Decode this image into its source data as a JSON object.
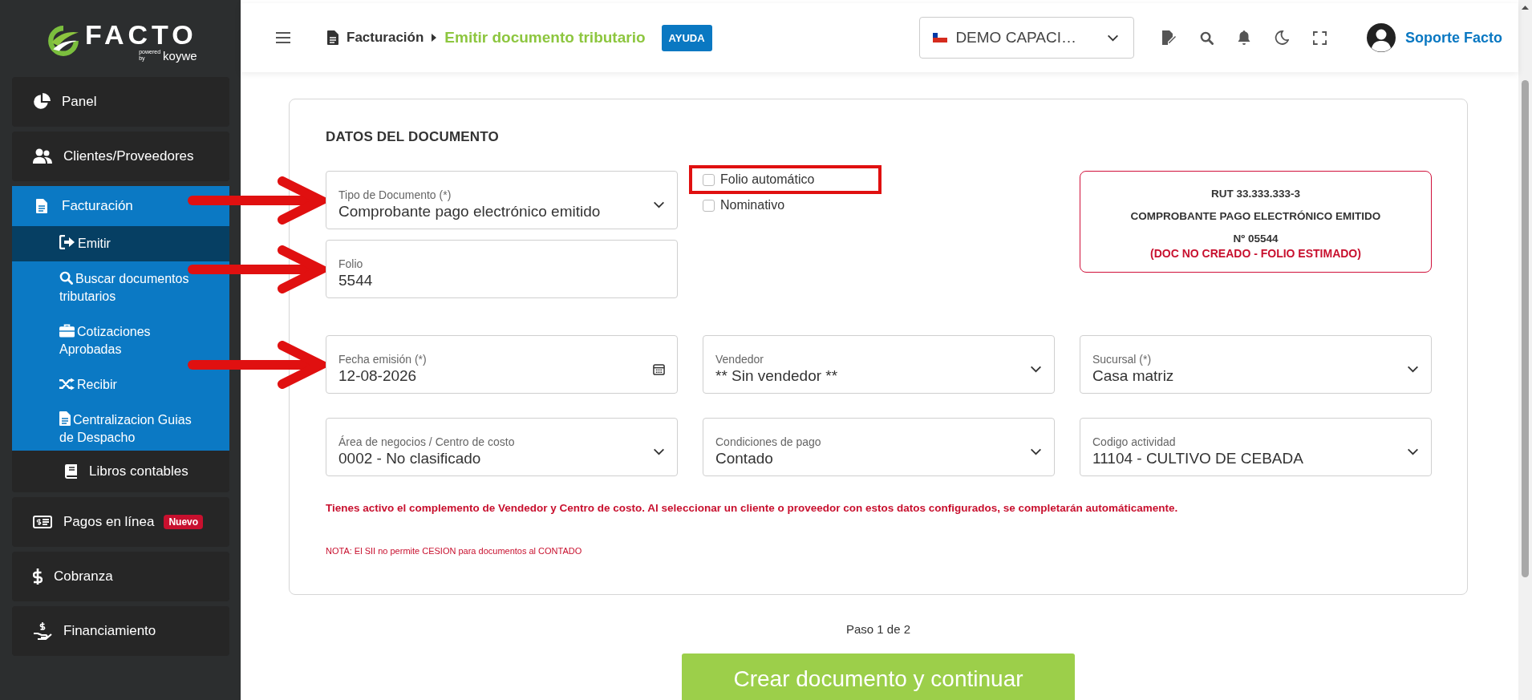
{
  "sidebar": {
    "logo": {
      "wordmark": "FACTO",
      "powered": "powered",
      "by": "by",
      "partner": "koywe"
    },
    "items": [
      {
        "label": "Panel",
        "kind": "item"
      },
      {
        "label": "Clientes/Proveedores",
        "kind": "item"
      },
      {
        "label": "Facturación",
        "kind": "group",
        "expanded": true,
        "children": [
          {
            "label": "Emitir",
            "selected": true
          },
          {
            "label": "Buscar documentos tributarios",
            "selected": false
          },
          {
            "label": "Cotizaciones Aprobadas",
            "selected": false
          },
          {
            "label": "Recibir",
            "selected": false
          },
          {
            "label": "Centralizacion Guias de Despacho",
            "selected": false
          }
        ]
      },
      {
        "label": "Libros contables",
        "kind": "subitem"
      },
      {
        "label": "Pagos en línea",
        "kind": "item",
        "badge": "Nuevo"
      },
      {
        "label": "Cobranza",
        "kind": "item"
      },
      {
        "label": "Financiamiento",
        "kind": "item"
      }
    ]
  },
  "header": {
    "breadcrumb": [
      {
        "label": "Facturación",
        "current": false
      },
      {
        "label": "Emitir documento tributario",
        "current": true
      }
    ],
    "help_button": "AYUDA",
    "company_selector": "DEMO CAPACI…",
    "user_name": "Soporte Facto"
  },
  "form": {
    "title": "DATOS DEL DOCUMENTO",
    "fields": [
      {
        "label": "Tipo de Documento (*)",
        "value": "Comprobante pago electrónico emitido",
        "kind": "select",
        "pointed": true
      },
      {
        "label": "Folio",
        "value": "5544",
        "kind": "text",
        "pointed": true
      },
      {
        "label": "Fecha emisión (*)",
        "value": "12-08-2026",
        "kind": "date",
        "pointed": true
      },
      {
        "label": "Vendedor",
        "value": "** Sin vendedor **",
        "kind": "select",
        "pointed": false
      },
      {
        "label": "Sucursal (*)",
        "value": "Casa matriz",
        "kind": "select",
        "pointed": false
      },
      {
        "label": "Área de negocios / Centro de costo",
        "value": "0002 - No clasificado",
        "kind": "select",
        "pointed": false
      },
      {
        "label": "Condiciones de pago",
        "value": "Contado",
        "kind": "select",
        "pointed": false
      },
      {
        "label": "Codigo actividad",
        "value": "11104 - CULTIVO DE CEBADA",
        "kind": "select",
        "pointed": false
      }
    ],
    "checkboxes": [
      {
        "label": "Folio automático",
        "checked": false,
        "highlighted": true
      },
      {
        "label": "Nominativo",
        "checked": false,
        "highlighted": false
      }
    ],
    "summary": {
      "rut": "RUT 33.333.333-3",
      "document_type": "COMPROBANTE PAGO ELECTRÓNICO EMITIDO",
      "number": "Nº 05544",
      "status": "(DOC NO CREADO - FOLIO ESTIMADO)"
    },
    "notice": "Tienes activo el complemento de Vendedor y Centro de costo. Al seleccionar un cliente o proveedor con estos datos configurados, se completarán automáticamente.",
    "note": "NOTA: El SII no permite CESION para documentos al CONTADO"
  },
  "step": "Paso 1 de 2",
  "submit_button": "Crear documento y continuar"
}
